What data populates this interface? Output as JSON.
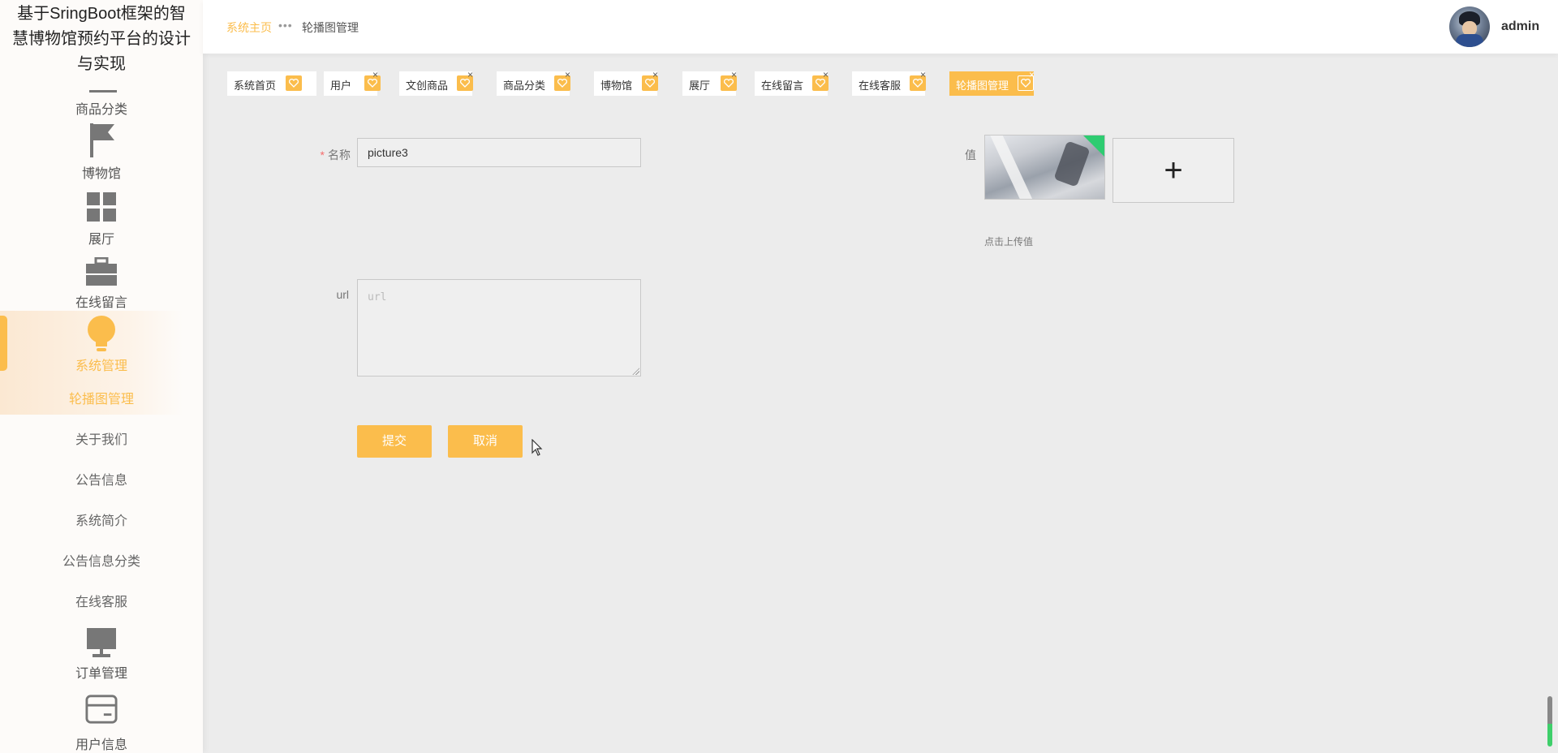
{
  "sidebar": {
    "title_lines": [
      "基于SringBoot框架的智",
      "慧博物馆预约平台的设计",
      "与实现"
    ],
    "items": [
      {
        "label": "商品分类",
        "icon": "minus-icon"
      },
      {
        "label": "博物馆",
        "icon": "flag-icon"
      },
      {
        "label": "展厅",
        "icon": "grid-icon"
      },
      {
        "label": "在线留言",
        "icon": "briefcase-icon"
      },
      {
        "label": "系统管理",
        "icon": "lightbulb-icon"
      },
      {
        "label": "订单管理",
        "icon": "monitor-icon"
      },
      {
        "label": "用户信息",
        "icon": "card-icon"
      }
    ],
    "subitems": [
      "轮播图管理",
      "关于我们",
      "公告信息",
      "系统简介",
      "公告信息分类",
      "在线客服"
    ],
    "active_item": "系统管理",
    "active_subitem": "轮播图管理"
  },
  "header": {
    "breadcrumb_home": "系统主页",
    "breadcrumb_sep": "•••",
    "breadcrumb_current": "轮播图管理",
    "username": "admin"
  },
  "tabs": [
    {
      "label": "系统首页",
      "closable": false,
      "active": false
    },
    {
      "label": "用户",
      "closable": true,
      "active": false
    },
    {
      "label": "文创商品",
      "closable": true,
      "active": false
    },
    {
      "label": "商品分类",
      "closable": true,
      "active": false
    },
    {
      "label": "博物馆",
      "closable": true,
      "active": false
    },
    {
      "label": "展厅",
      "closable": true,
      "active": false
    },
    {
      "label": "在线留言",
      "closable": true,
      "active": false
    },
    {
      "label": "在线客服",
      "closable": true,
      "active": false
    },
    {
      "label": "轮播图管理",
      "closable": true,
      "active": true
    }
  ],
  "tab_close_symbol": "×",
  "form": {
    "name_required_mark": "*",
    "name_label": "名称",
    "name_value": "picture3",
    "url_label": "url",
    "url_placeholder": "url",
    "value_label": "值",
    "upload_tip": "点击上传值",
    "upload_symbol": "+",
    "submit_label": "提交",
    "cancel_label": "取消"
  },
  "colors": {
    "accent": "#fbbd4c",
    "background": "#ececec",
    "sidebar_bg": "#fdfbf9"
  }
}
